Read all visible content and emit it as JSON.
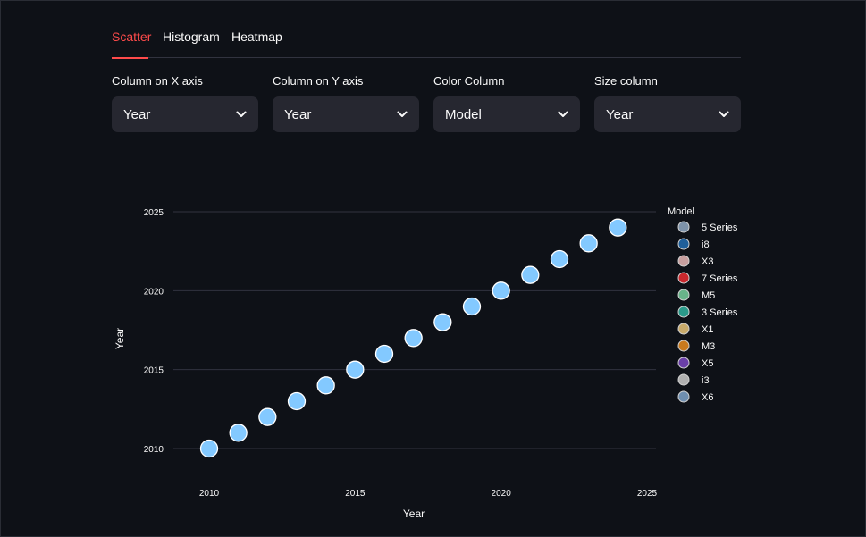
{
  "tabs": [
    {
      "label": "Scatter",
      "active": true
    },
    {
      "label": "Histogram",
      "active": false
    },
    {
      "label": "Heatmap",
      "active": false
    }
  ],
  "controls": [
    {
      "label": "Column on X axis",
      "value": "Year"
    },
    {
      "label": "Column on Y axis",
      "value": "Year"
    },
    {
      "label": "Color Column",
      "value": "Model"
    },
    {
      "label": "Size column",
      "value": "Year"
    }
  ],
  "colors": {
    "background": "#0e1117",
    "accent": "#ff4b4b",
    "select_bg": "#262730",
    "gridline": "#31333f",
    "marker": "#83c9ff"
  },
  "chart_data": {
    "type": "scatter",
    "xlabel": "Year",
    "ylabel": "Year",
    "xlim": [
      2008.5,
      2025
    ],
    "ylim": [
      2008,
      2026
    ],
    "x_ticks": [
      2010,
      2015,
      2020,
      2025
    ],
    "y_ticks": [
      2010,
      2015,
      2020,
      2025
    ],
    "grid": "horizontal",
    "points": [
      {
        "x": 2010,
        "y": 2010
      },
      {
        "x": 2011,
        "y": 2011
      },
      {
        "x": 2012,
        "y": 2012
      },
      {
        "x": 2013,
        "y": 2013
      },
      {
        "x": 2014,
        "y": 2014
      },
      {
        "x": 2015,
        "y": 2015
      },
      {
        "x": 2016,
        "y": 2016
      },
      {
        "x": 2017,
        "y": 2017
      },
      {
        "x": 2018,
        "y": 2018
      },
      {
        "x": 2019,
        "y": 2019
      },
      {
        "x": 2020,
        "y": 2020
      },
      {
        "x": 2021,
        "y": 2021
      },
      {
        "x": 2022,
        "y": 2022
      },
      {
        "x": 2023,
        "y": 2023
      },
      {
        "x": 2024,
        "y": 2024
      }
    ],
    "legend": {
      "title": "Model",
      "placement": "right",
      "items": [
        {
          "label": "5 Series",
          "color": "#7e93aa"
        },
        {
          "label": "i8",
          "color": "#1f5f9a"
        },
        {
          "label": "X3",
          "color": "#c79f9f"
        },
        {
          "label": "7 Series",
          "color": "#c9282d"
        },
        {
          "label": "M5",
          "color": "#69b38a"
        },
        {
          "label": "3 Series",
          "color": "#2a9a8a"
        },
        {
          "label": "X1",
          "color": "#c8aa6a"
        },
        {
          "label": "M3",
          "color": "#c97a1e"
        },
        {
          "label": "X5",
          "color": "#6a3fa8"
        },
        {
          "label": "i3",
          "color": "#b0b0b0"
        },
        {
          "label": "X6",
          "color": "#6f8fb0"
        }
      ]
    }
  }
}
